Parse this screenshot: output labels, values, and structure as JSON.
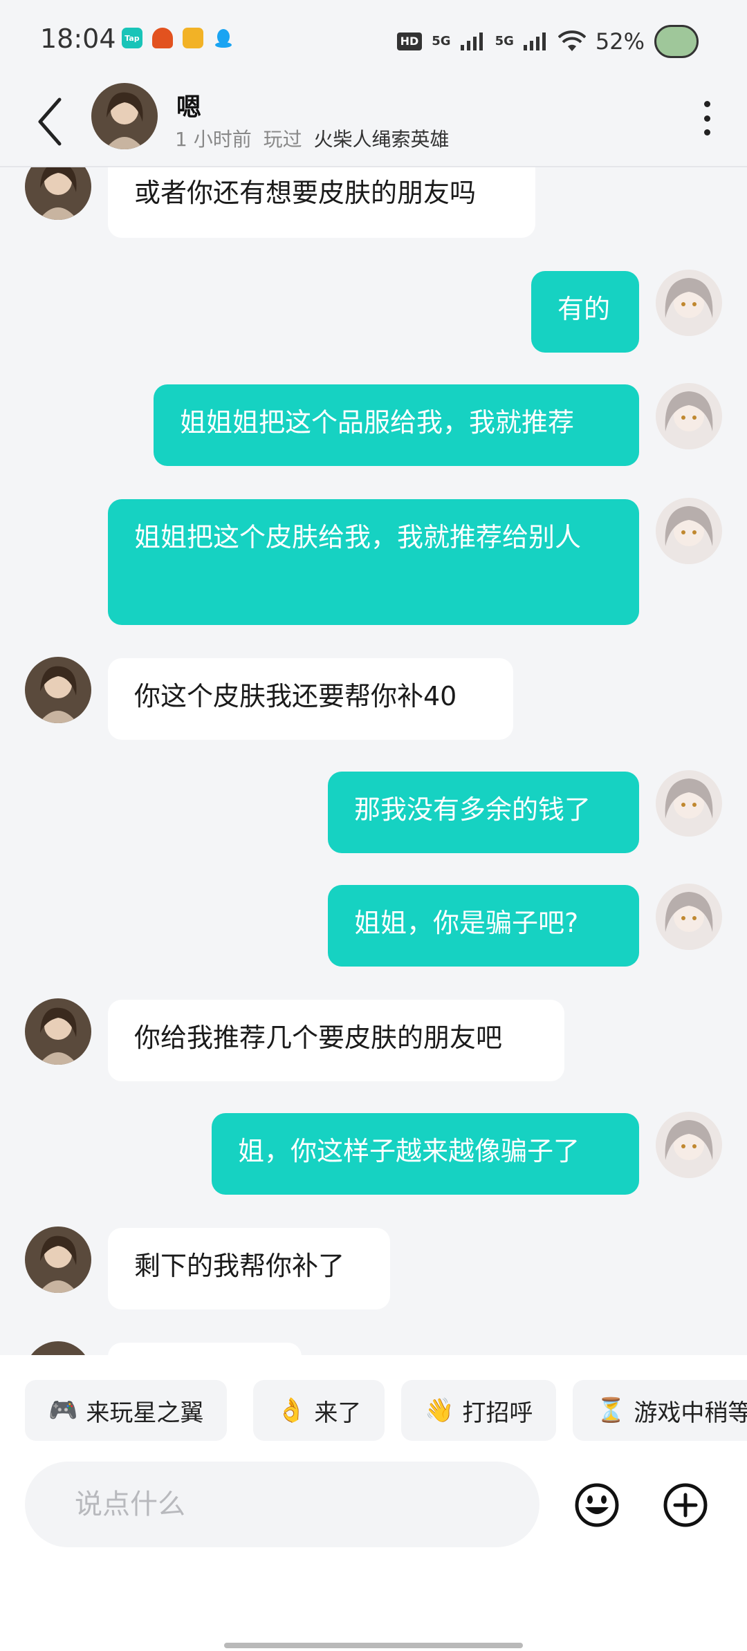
{
  "status_bar": {
    "time": "18:04",
    "network_hd": "HD",
    "network_5g_1": "5G",
    "network_5g_2": "5G",
    "battery": "52%"
  },
  "header": {
    "name": "嗯",
    "last_active": "1 小时前",
    "played_label": "玩过",
    "game": "火柴人绳索英雄"
  },
  "messages": [
    {
      "from": "them",
      "text": "或者你还有想要皮肤的朋友吗"
    },
    {
      "from": "me",
      "text": "有的"
    },
    {
      "from": "me",
      "text": "姐姐姐把这个品服给我，我就推荐"
    },
    {
      "from": "me",
      "text": "姐姐把这个皮肤给我，我就推荐给别人"
    },
    {
      "from": "them",
      "text": "你这个皮肤我还要帮你补40"
    },
    {
      "from": "me",
      "text": "那我没有多余的钱了"
    },
    {
      "from": "me",
      "text": "姐姐，你是骗子吧?"
    },
    {
      "from": "them",
      "text": "你给我推荐几个要皮肤的朋友吧"
    },
    {
      "from": "me",
      "text": "姐，你这样子越来越像骗子了"
    },
    {
      "from": "them",
      "text": "剩下的我帮你补了"
    }
  ],
  "quick_replies": [
    {
      "emoji": "🎮",
      "label": "来玩星之翼"
    },
    {
      "emoji": "👌",
      "label": "来了"
    },
    {
      "emoji": "👋",
      "label": "打招呼"
    },
    {
      "emoji": "⏳",
      "label": "游戏中稍等"
    }
  ],
  "input": {
    "placeholder": "说点什么"
  },
  "colors": {
    "outgoing_bubble": "#16d2c2",
    "incoming_bubble": "#ffffff",
    "background": "#f4f5f7"
  },
  "icons": [
    "back-arrow-icon",
    "more-vertical-icon",
    "emoji-icon",
    "plus-circle-icon",
    "wifi-icon",
    "battery-cloud-icon"
  ]
}
